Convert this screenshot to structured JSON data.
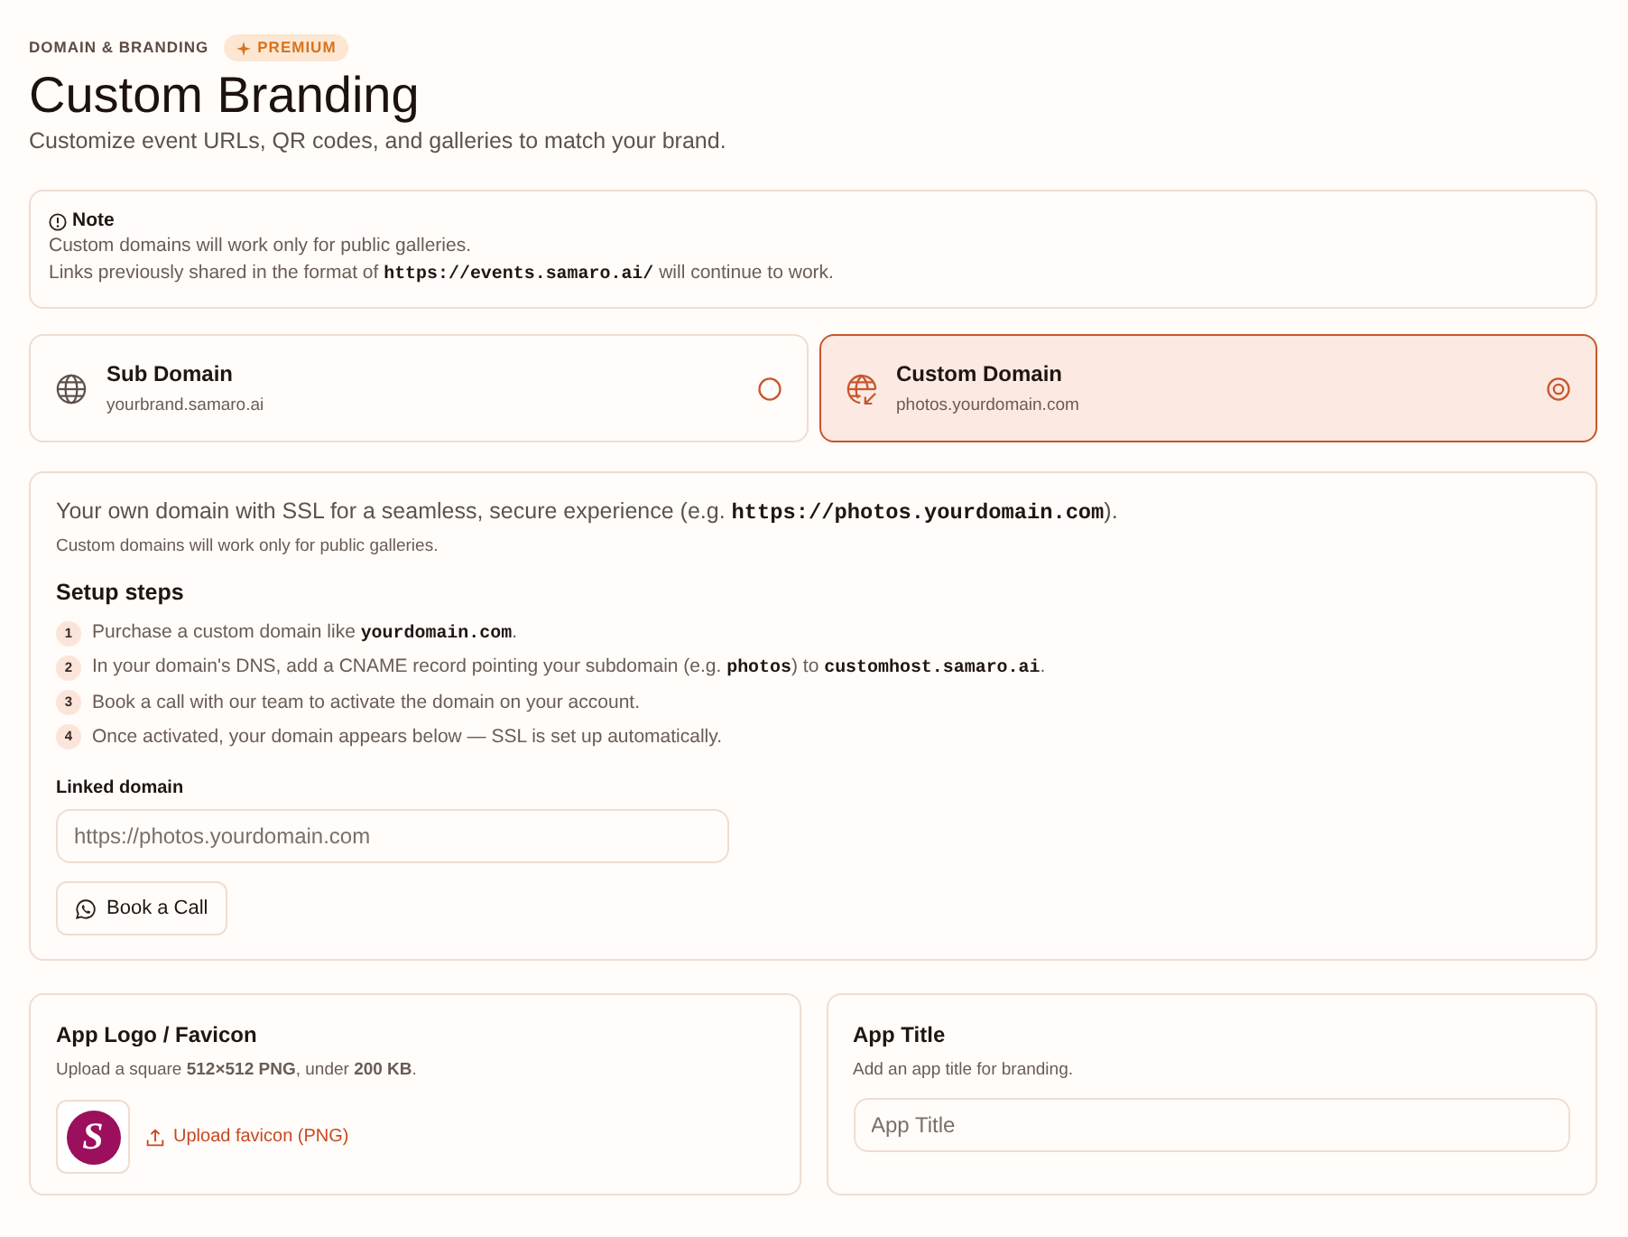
{
  "header": {
    "eyebrow": "DOMAIN & BRANDING",
    "badge": "PREMIUM",
    "title": "Custom Branding",
    "subtitle": "Customize event URLs, QR codes, and galleries to match your brand."
  },
  "note": {
    "title": "Note",
    "lines": [
      {
        "parts": [
          {
            "kind": "text",
            "text": "Custom domains will work only for public galleries."
          }
        ]
      },
      {
        "parts": [
          {
            "kind": "text",
            "text": "Links previously shared in the format of "
          },
          {
            "kind": "code",
            "text": "https://events.samaro.ai/"
          },
          {
            "kind": "text",
            "text": " will continue to work."
          }
        ]
      }
    ]
  },
  "domain_options": [
    {
      "kind": "subdomain",
      "title": "Sub Domain",
      "example": "yourbrand.samaro.ai",
      "selected": false
    },
    {
      "kind": "custom",
      "title": "Custom Domain",
      "example": "photos.yourdomain.com",
      "selected": true
    }
  ],
  "setup": {
    "intro": [
      {
        "kind": "text",
        "text": "Your own domain with SSL for a seamless, secure experience (e.g. "
      },
      {
        "kind": "code",
        "text": "https://photos.yourdomain.com"
      },
      {
        "kind": "text",
        "text": ")."
      }
    ],
    "hint": "Custom domains will work only for public galleries.",
    "steps_title": "Setup steps",
    "steps": [
      {
        "number": "1",
        "parts": [
          {
            "kind": "text",
            "text": "Purchase a custom domain like "
          },
          {
            "kind": "code",
            "text": "yourdomain.com"
          },
          {
            "kind": "text",
            "text": "."
          }
        ]
      },
      {
        "number": "2",
        "parts": [
          {
            "kind": "text",
            "text": "In your domain's DNS, add a CNAME record pointing your subdomain (e.g. "
          },
          {
            "kind": "code",
            "text": "photos"
          },
          {
            "kind": "text",
            "text": ") to "
          },
          {
            "kind": "code",
            "text": "customhost.samaro.ai"
          },
          {
            "kind": "text",
            "text": "."
          }
        ]
      },
      {
        "number": "3",
        "parts": [
          {
            "kind": "text",
            "text": "Book a call with our team to activate the domain on your account."
          }
        ]
      },
      {
        "number": "4",
        "parts": [
          {
            "kind": "text",
            "text": "Once activated, your domain appears below — SSL is set up automatically."
          }
        ]
      }
    ],
    "linked_domain": {
      "label": "Linked domain",
      "placeholder": "https://photos.yourdomain.com"
    },
    "button": "Book a Call"
  },
  "logo_card": {
    "title": "App Logo / Favicon",
    "description": "Upload a square **512×512 PNG**, under **200 KB**.",
    "logo_letter": "S",
    "upload_link": "Upload favicon (PNG)"
  },
  "title_card": {
    "title": "App Title",
    "description": "Add an app title for branding.",
    "field": {
      "placeholder": "App Title"
    }
  }
}
